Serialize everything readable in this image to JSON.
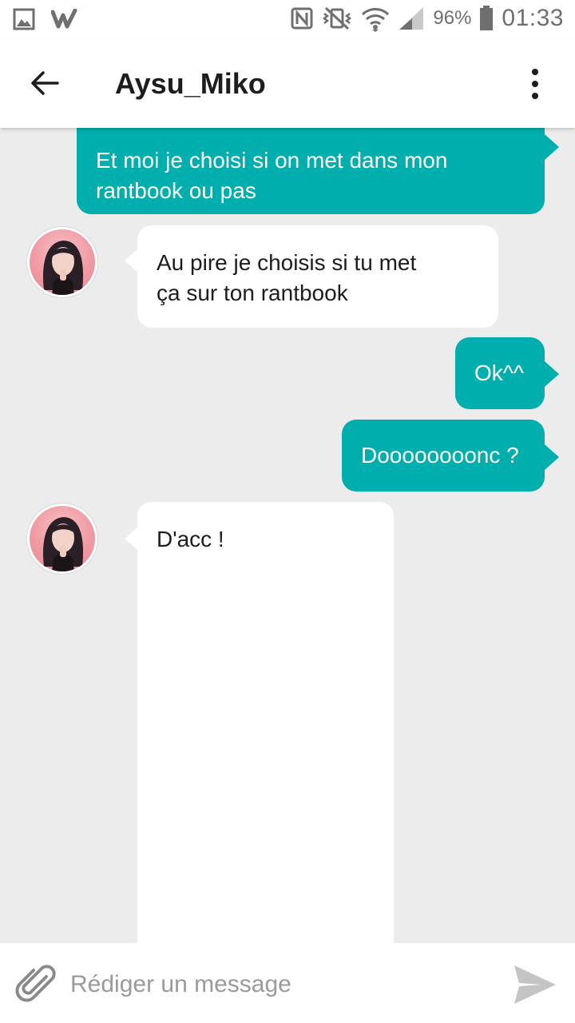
{
  "status_bar": {
    "battery": "96%",
    "time": "01:33",
    "left_icons": [
      "gallery-icon",
      "wattpad-icon"
    ],
    "right_icons": [
      "nfc-icon",
      "vibrate-mute-icon",
      "wifi-icon",
      "signal-icon",
      "battery-icon"
    ]
  },
  "header": {
    "title": "Aysu_Miko",
    "back_icon": "arrow-left-icon",
    "menu_icon": "more-vertical-icon"
  },
  "messages": [
    {
      "from": "me",
      "lines": [
        "Et moi je choisi si on met dans mon",
        "rantbook ou pas"
      ]
    },
    {
      "from": "Aysu_Miko",
      "lines": [
        "Au pire je choisis si tu met",
        "ça sur ton rantbook"
      ]
    },
    {
      "from": "me",
      "lines": [
        "Ok^^"
      ]
    },
    {
      "from": "me",
      "lines": [
        "Doooooooonc ?"
      ]
    },
    {
      "from": "Aysu_Miko",
      "lines": [
        "D'acc !"
      ]
    }
  ],
  "composer": {
    "placeholder": "Rédiger un message",
    "attach_icon": "paperclip-icon",
    "send_icon": "send-icon"
  },
  "colors": {
    "outgoing_bubble": "#00aead",
    "incoming_bubble": "#ffffff",
    "background": "#ececec"
  }
}
